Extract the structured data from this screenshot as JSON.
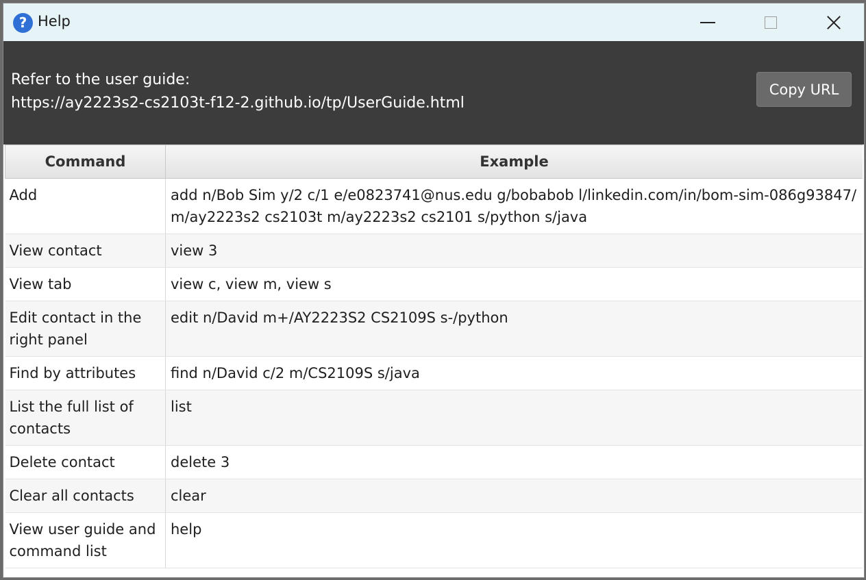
{
  "window": {
    "title": "Help",
    "icon": "help-question-icon"
  },
  "header": {
    "guide_label": "Refer to the user guide:",
    "guide_url": "https://ay2223s2-cs2103t-f12-2.github.io/tp/UserGuide.html",
    "copy_button": "Copy URL"
  },
  "table": {
    "columns": [
      "Command",
      "Example"
    ],
    "rows": [
      {
        "command": "Add",
        "example": "add n/Bob Sim y/2 c/1 e/e0823741@nus.edu g/bobabob l/linkedin.com/in/bom-sim-086g93847/ m/ay2223s2 cs2103t m/ay2223s2 cs2101 s/python s/java"
      },
      {
        "command": "View contact",
        "example": "view 3"
      },
      {
        "command": "View tab",
        "example": "view c, view m, view s"
      },
      {
        "command": "Edit contact in the right panel",
        "example": "edit n/David m+/AY2223S2 CS2109S s-/python"
      },
      {
        "command": "Find by attributes",
        "example": "find n/David c/2 m/CS2109S s/java"
      },
      {
        "command": "List the full list of contacts",
        "example": "list"
      },
      {
        "command": "Delete contact",
        "example": "delete 3"
      },
      {
        "command": "Clear all contacts",
        "example": "clear"
      },
      {
        "command": "View user guide and command list",
        "example": "help"
      }
    ]
  }
}
